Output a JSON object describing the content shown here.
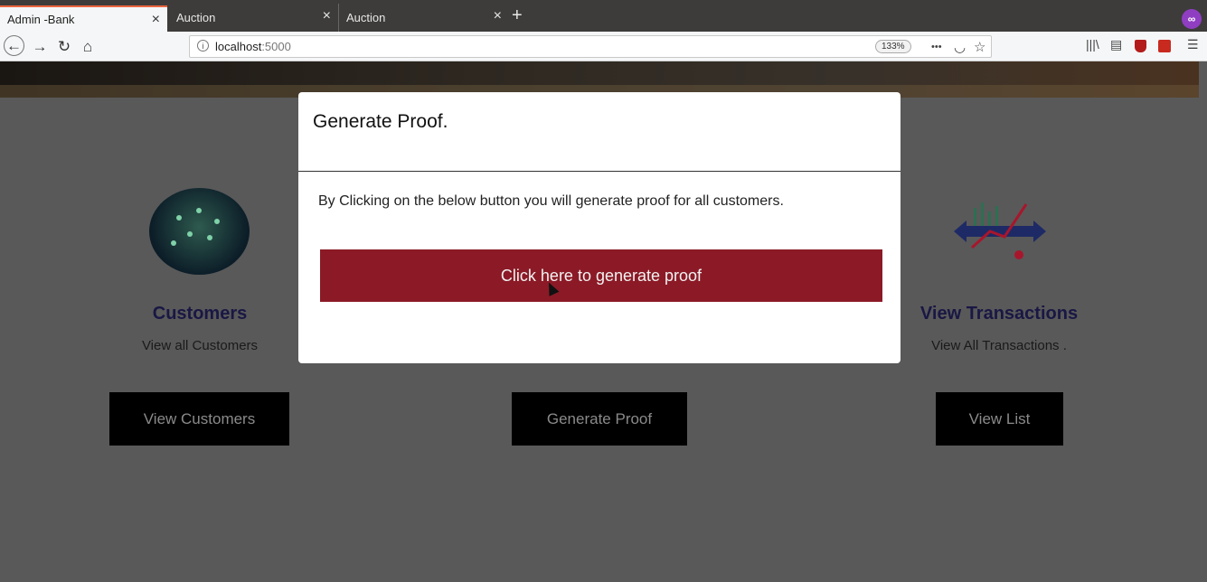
{
  "browser": {
    "tabs": [
      {
        "title": "Admin -Bank",
        "close": "×"
      },
      {
        "title": "Auction",
        "close": "×"
      },
      {
        "title": "Auction",
        "close": "×"
      }
    ],
    "new_tab": "+",
    "url_host": "localhost",
    "url_port": ":5000",
    "zoom": "133%",
    "more": "•••"
  },
  "page": {
    "cards": [
      {
        "title": "Customers",
        "subtitle": "View all Customers",
        "button": "View Customers"
      },
      {
        "title": "",
        "subtitle": "",
        "button": "Generate Proof"
      },
      {
        "title": "View Transactions",
        "subtitle": "View All Transactions .",
        "button": "View List"
      }
    ]
  },
  "modal": {
    "title": "Generate Proof.",
    "text": "By Clicking on the below button you will generate proof for all customers.",
    "button": "Click here to generate proof"
  },
  "colors": {
    "primary_button": "#8b1a26",
    "card_title": "#191744",
    "dark_button": "#000000"
  }
}
